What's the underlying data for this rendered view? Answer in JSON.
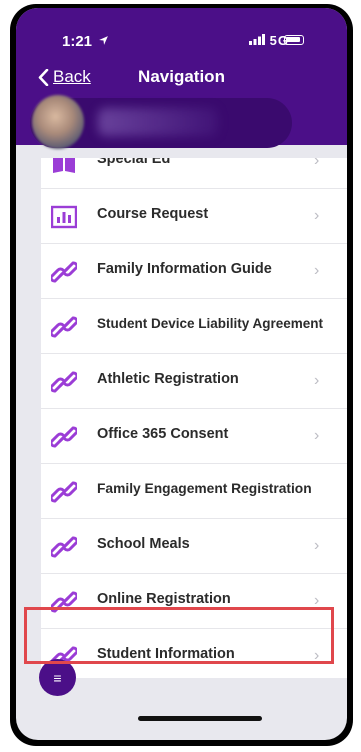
{
  "status_bar": {
    "time": "1:21",
    "signal": "5G"
  },
  "nav": {
    "back_label": "Back",
    "title": "Navigation"
  },
  "colors": {
    "primary": "#4b0f88",
    "icon": "#9b3dd6",
    "highlight": "#e0474c"
  },
  "list": {
    "items": [
      {
        "label": "Special Ed",
        "icon": "book-icon",
        "chevron": "›"
      },
      {
        "label": "Course Request",
        "icon": "chart-icon",
        "chevron": "›"
      },
      {
        "label": "Family Information Guide",
        "icon": "link-icon",
        "chevron": "›"
      },
      {
        "label": "Student Device Liability Agreement",
        "icon": "link-icon",
        "chevron": ""
      },
      {
        "label": "Athletic Registration",
        "icon": "link-icon",
        "chevron": "›"
      },
      {
        "label": "Office 365 Consent",
        "icon": "link-icon",
        "chevron": "›"
      },
      {
        "label": "Family Engagement Registration",
        "icon": "link-icon",
        "chevron": ""
      },
      {
        "label": "School Meals",
        "icon": "link-icon",
        "chevron": "›"
      },
      {
        "label": "Online Registration",
        "icon": "link-icon",
        "chevron": "›"
      },
      {
        "label": "Student Information",
        "icon": "link-icon",
        "chevron": "›",
        "highlighted": true
      }
    ]
  },
  "menu_button": {
    "icon": "menu-icon",
    "glyph": "≡"
  }
}
